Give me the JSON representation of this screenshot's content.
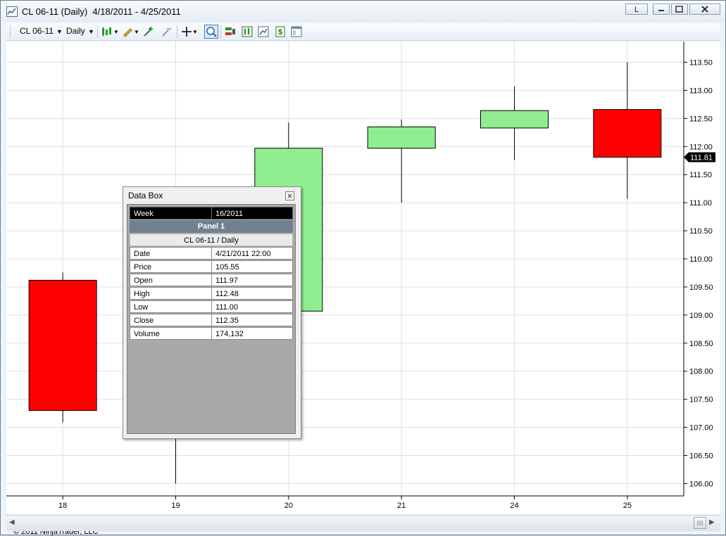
{
  "window": {
    "title": "CL 06-11 (Daily)  4/18/2011 - 4/25/2011",
    "link_button": "L"
  },
  "toolbar": {
    "instrument": "CL 06-11",
    "period": "Daily"
  },
  "colors": {
    "up_candle": "#90ee90",
    "down_candle": "#ff0000",
    "grid": "#e0e0e0",
    "databox_header_bg": "#000000",
    "databox_panel_bg": "#708090"
  },
  "chart_data": {
    "type": "candlestick",
    "instrument": "CL 06-11",
    "period": "Daily",
    "x": [
      "18",
      "19",
      "20",
      "21",
      "24",
      "25"
    ],
    "open": [
      109.62,
      107.3,
      109.07,
      111.97,
      112.33,
      112.66
    ],
    "high": [
      109.76,
      107.18,
      112.43,
      112.48,
      113.07,
      113.5
    ],
    "low": [
      107.09,
      106.0,
      108.95,
      111.0,
      111.76,
      111.07
    ],
    "close": [
      107.3,
      109.07,
      111.97,
      112.35,
      112.64,
      111.81
    ],
    "y_ticks": [
      "106.00",
      "106.50",
      "107.00",
      "107.50",
      "108.00",
      "108.50",
      "109.00",
      "109.50",
      "110.00",
      "110.50",
      "111.00",
      "111.50",
      "112.00",
      "112.50",
      "113.00",
      "113.50"
    ],
    "ylim": [
      105.78,
      113.87
    ],
    "last_price_label": "111.81",
    "grid": true
  },
  "copyright": "© 2011 NinjaTrader, LLC",
  "databox": {
    "title": "Data Box",
    "week_label": "Week",
    "week_value": "16/2011",
    "panel_label": "Panel 1",
    "series_label": "CL 06-11 / Daily",
    "rows": [
      {
        "label": "Date",
        "value": "4/21/2011 22:00"
      },
      {
        "label": "Price",
        "value": "105.55"
      },
      {
        "label": "Open",
        "value": "111.97"
      },
      {
        "label": "High",
        "value": "112.48"
      },
      {
        "label": "Low",
        "value": "111.00"
      },
      {
        "label": "Close",
        "value": "112.35"
      },
      {
        "label": "Volume",
        "value": "174,132"
      }
    ]
  }
}
